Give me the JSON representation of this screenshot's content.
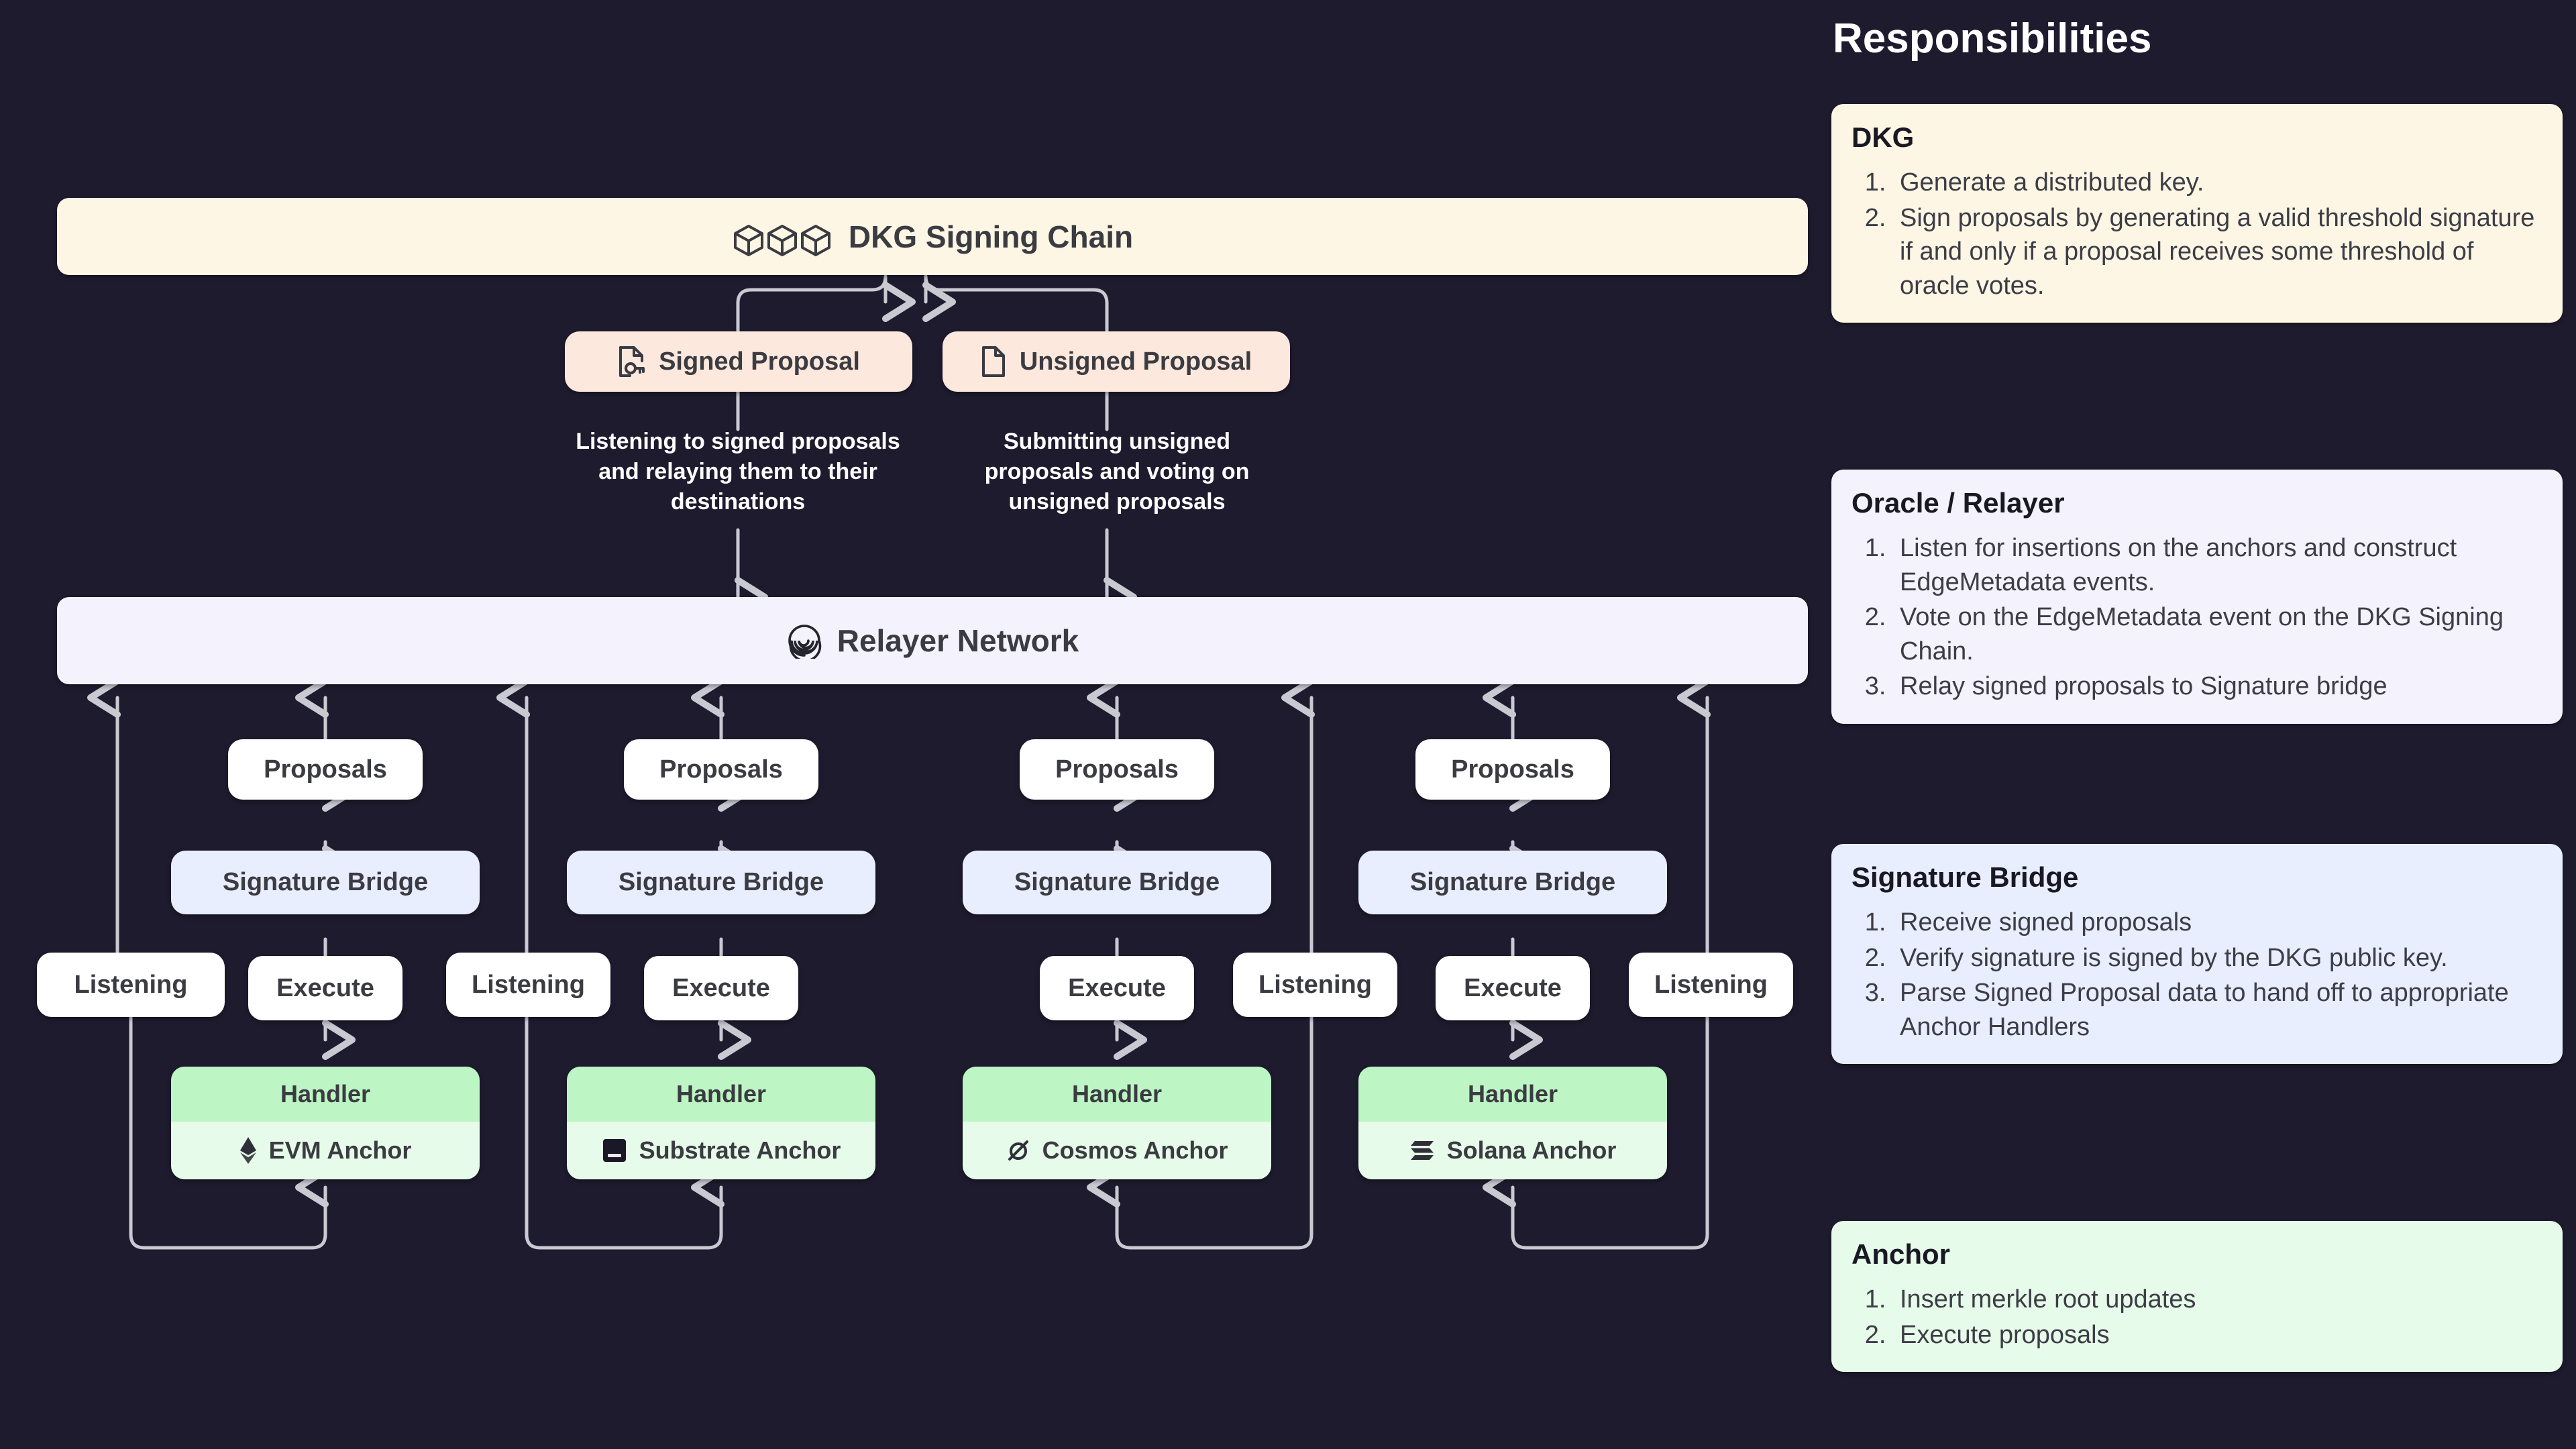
{
  "diagram": {
    "dkg_chain": {
      "label": "DKG Signing Chain",
      "icon": "cube-icon",
      "color": "#fdf6e4"
    },
    "proposal_chips": [
      {
        "label": "Signed Proposal",
        "icon": "signed-document-key-icon",
        "color": "#fce8dd"
      },
      {
        "label": "Unsigned  Proposal",
        "icon": "document-icon",
        "color": "#fce8dd"
      }
    ],
    "captions": [
      "Listening to signed proposals and relaying them to their destinations",
      "Submitting unsigned proposals and voting on unsigned proposals"
    ],
    "relayer_network": {
      "label": "Relayer Network",
      "icon": "spiral-icon",
      "color": "#f4f2fd"
    },
    "common_labels": {
      "proposals": "Proposals",
      "signature_bridge": "Signature Bridge",
      "listening": "Listening",
      "execute": "Execute",
      "handler": "Handler"
    },
    "columns": [
      {
        "anchor": "EVM Anchor",
        "anchor_icon": "ethereum-icon",
        "left_chip": "Listening",
        "right_chip": "Execute"
      },
      {
        "anchor": "Substrate Anchor",
        "anchor_icon": "substrate-icon",
        "left_chip": "Listening",
        "right_chip": "Execute"
      },
      {
        "anchor": "Cosmos Anchor",
        "anchor_icon": "cosmos-icon",
        "left_chip": "Execute",
        "right_chip": "Listening"
      },
      {
        "anchor": "Solana Anchor",
        "anchor_icon": "solana-icon",
        "left_chip": "Execute",
        "right_chip": "Listening"
      }
    ]
  },
  "responsibilities": {
    "title": "Responsibilities",
    "cards": [
      {
        "heading": "DKG",
        "color": "#fdf6e4",
        "items": [
          "Generate a distributed key.",
          "Sign proposals by generating a valid threshold signature if and only if a proposal receives some threshold of oracle votes."
        ]
      },
      {
        "heading": "Oracle / Relayer",
        "color": "#f4f2fd",
        "items": [
          "Listen for insertions on the anchors and construct EdgeMetadata events.",
          "Vote on the EdgeMetadata event on the DKG Signing Chain.",
          "Relay signed proposals to Signature bridge"
        ]
      },
      {
        "heading": "Signature Bridge",
        "color": "#e8eefd",
        "items": [
          "Receive signed proposals",
          "Verify signature is signed by the DKG public key.",
          "Parse Signed Proposal data to hand off to appropriate Anchor Handlers"
        ]
      },
      {
        "heading": "Anchor",
        "color": "#e6fbe9",
        "items": [
          "Insert merkle root updates",
          "Execute proposals"
        ]
      }
    ]
  }
}
